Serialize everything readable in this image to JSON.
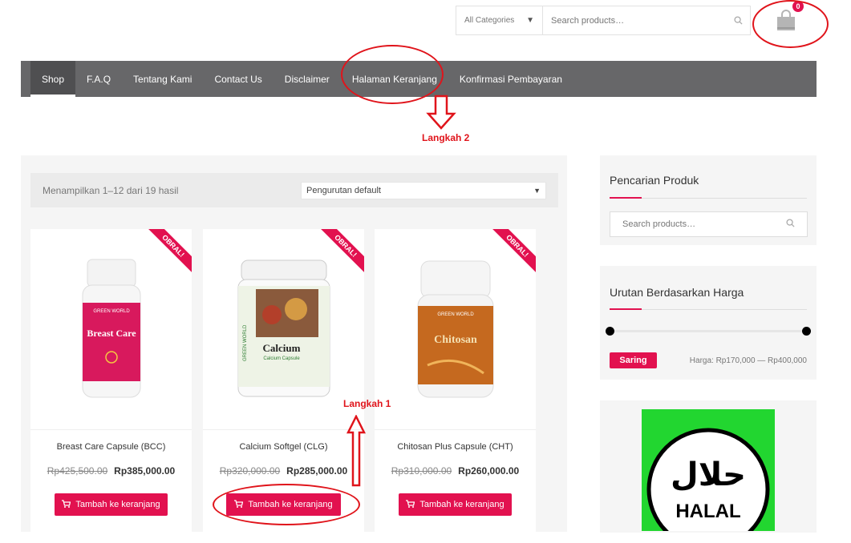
{
  "header": {
    "category_label": "All Categories",
    "search_placeholder": "Search products…",
    "cart_count": "0"
  },
  "nav": {
    "items": [
      "Shop",
      "F.A.Q",
      "Tentang Kami",
      "Contact Us",
      "Disclaimer",
      "Halaman Keranjang",
      "Konfirmasi Pembayaran"
    ],
    "active": "Shop"
  },
  "annotations": {
    "step1": "Langkah 1",
    "step2": "Langkah 2",
    "color": "#e0141b"
  },
  "shop": {
    "result_count": "Menampilkan 1–12 dari 19 hasil",
    "orderby": "Pengurutan default",
    "sale_badge": "OBRAL!",
    "add_to_cart_label": "Tambah ke keranjang",
    "products": [
      {
        "name": "Breast Care Capsule (BCC)",
        "old_price": "Rp425,500.00",
        "price": "Rp385,000.00",
        "label": "Breast Care",
        "brand": "GREEN WORLD"
      },
      {
        "name": "Calcium Softgel (CLG)",
        "old_price": "Rp320,000.00",
        "price": "Rp285,000.00",
        "label": "Calcium",
        "sublabel": "Calcium Capsule",
        "brand": "GREEN WORLD"
      },
      {
        "name": "Chitosan Plus Capsule (CHT)",
        "old_price": "Rp310,000.00",
        "price": "Rp260,000.00",
        "label": "Chitosan",
        "brand": "GREEN WORLD"
      }
    ]
  },
  "sidebar": {
    "search_title": "Pencarian Produk",
    "search_placeholder": "Search products…",
    "price_title": "Urutan Berdasarkan Harga",
    "filter_button": "Saring",
    "price_range": "Harga: Rp170,000 — Rp400,000",
    "halal_text": "HALAL",
    "halal_arabic": "حلال"
  },
  "colors": {
    "accent": "#e2114f",
    "nav_bg": "#676769",
    "halal_green": "#22d630"
  }
}
